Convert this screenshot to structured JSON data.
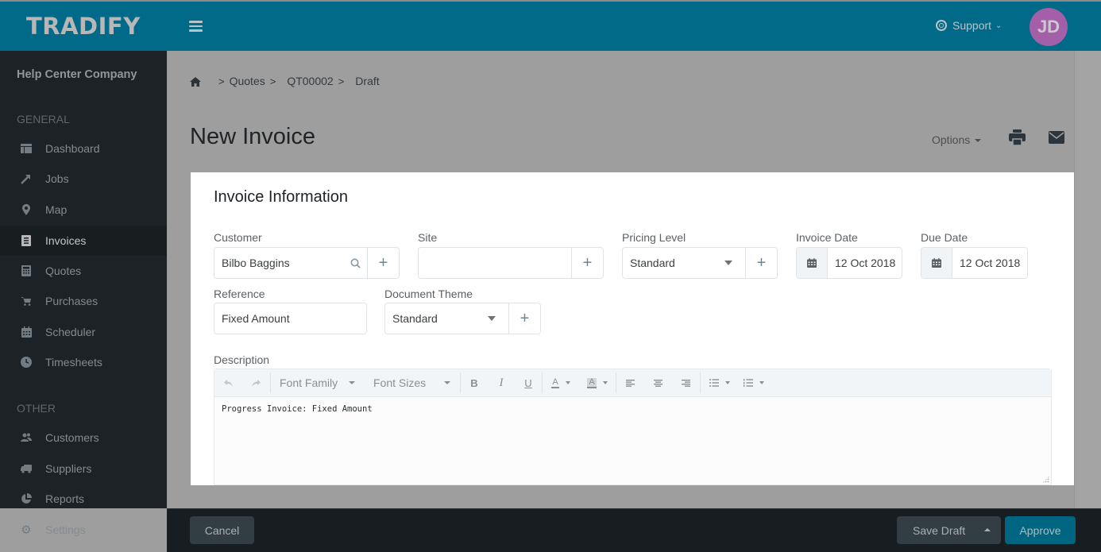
{
  "app": {
    "logo": "TRADIFY",
    "support_label": "Support",
    "avatar_initials": "JD",
    "colors": {
      "brand": "#006a88",
      "avatar": "#a35fa7",
      "approve": "#006580"
    }
  },
  "sidebar": {
    "company": "Help Center Company",
    "sections": [
      {
        "label": "GENERAL",
        "items": [
          {
            "label": "Dashboard",
            "icon": "dashboard-icon"
          },
          {
            "label": "Jobs",
            "icon": "hammer-icon"
          },
          {
            "label": "Map",
            "icon": "map-marker-icon"
          },
          {
            "label": "Invoices",
            "icon": "invoice-icon",
            "active": true
          },
          {
            "label": "Quotes",
            "icon": "calculator-icon"
          },
          {
            "label": "Purchases",
            "icon": "cart-icon"
          },
          {
            "label": "Scheduler",
            "icon": "calendar-icon"
          },
          {
            "label": "Timesheets",
            "icon": "clock-icon"
          }
        ]
      },
      {
        "label": "OTHER",
        "items": [
          {
            "label": "Customers",
            "icon": "users-icon"
          },
          {
            "label": "Suppliers",
            "icon": "truck-icon"
          },
          {
            "label": "Reports",
            "icon": "pie-chart-icon"
          },
          {
            "label": "Settings",
            "icon": "gear-icon"
          }
        ]
      }
    ]
  },
  "breadcrumb": [
    "Quotes",
    "QT00002",
    "Draft"
  ],
  "page": {
    "title": "New Invoice",
    "options_label": "Options"
  },
  "card": {
    "title": "Invoice Information",
    "customer": {
      "label": "Customer",
      "value": "Bilbo Baggins"
    },
    "site": {
      "label": "Site",
      "value": ""
    },
    "pricing_level": {
      "label": "Pricing Level",
      "value": "Standard"
    },
    "invoice_date": {
      "label": "Invoice Date",
      "value": "12 Oct 2018"
    },
    "due_date": {
      "label": "Due Date",
      "value": "12 Oct 2018"
    },
    "reference": {
      "label": "Reference",
      "value": "Fixed Amount"
    },
    "document_theme": {
      "label": "Document Theme",
      "value": "Standard"
    },
    "description": {
      "label": "Description",
      "toolbar": {
        "font_family": "Font Family",
        "font_sizes": "Font Sizes",
        "bold": "B",
        "italic": "I",
        "underline": "U",
        "text_color": "A",
        "bg_color": "A"
      },
      "content": "Progress Invoice: Fixed Amount"
    }
  },
  "footer": {
    "cancel": "Cancel",
    "save_draft": "Save Draft",
    "approve": "Approve"
  }
}
